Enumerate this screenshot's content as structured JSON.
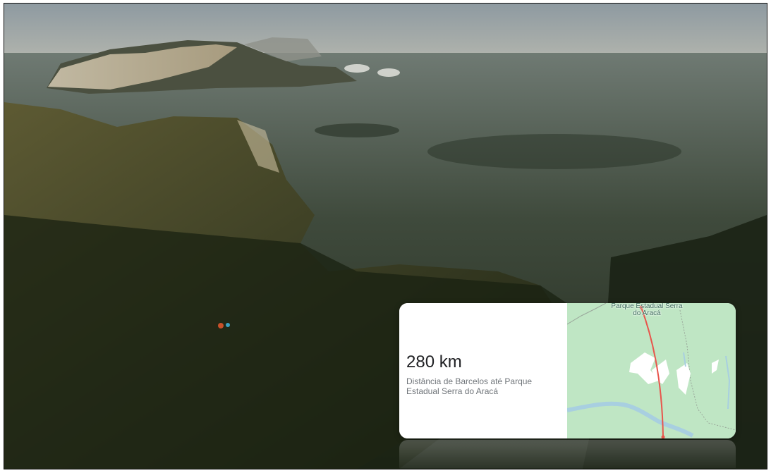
{
  "video": {
    "scene": "aerial-forest-plateau"
  },
  "info_card": {
    "distance": "280 km",
    "description": "Distância de Barcelos até Parque Estadual Serra do Aracá"
  },
  "map": {
    "place_label": "Parque Estadual Serra do Aracá",
    "colors": {
      "land": "#bfe6c4",
      "water": "#a8cfe0",
      "route": "#e8554c",
      "rock": "#ffffff"
    }
  }
}
